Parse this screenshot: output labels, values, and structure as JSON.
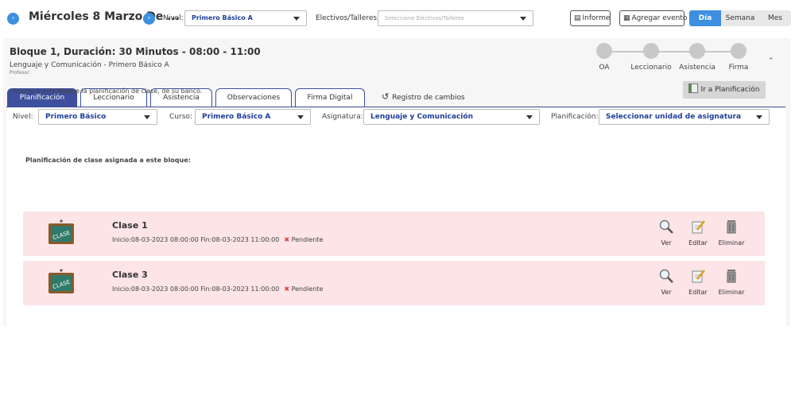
{
  "topbar": {
    "date_title": "Miércoles 8 Marzo De ...",
    "nivel_label": "Nivel:",
    "nivel_value": "Primero Básico A",
    "electivos_label": "Electivos/Talleres:",
    "electivos_placeholder": "Seleccione Electivos/Talleres",
    "informe_label": "Informe",
    "agregar_label": "Agregar evento",
    "view_tabs": [
      "Día",
      "Semana",
      "Mes"
    ],
    "active_view": "Día",
    "accent_color": "#3d8fe0"
  },
  "bloque": {
    "title": "Bloque 1, Duración: 30 Minutos - 08:00 - 11:00",
    "subtitle": "Lenguaje y Comunicación - Primero Básico A",
    "profesor": "Profesor:",
    "steps": [
      "OA",
      "Leccionario",
      "Asistencia",
      "Firma"
    ]
  },
  "tabs": {
    "items": [
      "Planificación",
      "Leccionario",
      "Asistencia",
      "Observaciones",
      "Firma Digital"
    ],
    "active": "Planificación",
    "history_label": "Registro de cambios",
    "tab_color": "#3d4f9e"
  },
  "planificacion": {
    "assign_text": "Asigne a este bloque la planificación de clase, de su banco.",
    "ir_button": "Ir a Planificación",
    "filters": {
      "nivel_label": "Nivel:",
      "nivel_value": "Primero Básico",
      "curso_label": "Curso:",
      "curso_value": "Primero Básico A",
      "asignatura_label": "Asignatura:",
      "asignatura_value": "Lenguaje y Comunicación",
      "planificacion_label": "Planificación:",
      "planificacion_value": "Seleccionar unidad de asignatura"
    },
    "assigned_title": "Planificación de clase asignada a este bloque:",
    "thumb_text": "CLASE",
    "clases": [
      {
        "name": "Clase 1",
        "info": "Inicio:08-03-2023 08:00:00 Fin:08-03-2023 11:00:00",
        "status": "Pendiente"
      },
      {
        "name": "Clase 3",
        "info": "Inicio:08-03-2023 08:00:00 Fin:08-03-2023 11:00:00",
        "status": "Pendiente"
      }
    ],
    "actions": [
      "Ver",
      "Editar",
      "Eliminar"
    ],
    "row_color": "#fde4e6",
    "status_color": "#e53935"
  }
}
